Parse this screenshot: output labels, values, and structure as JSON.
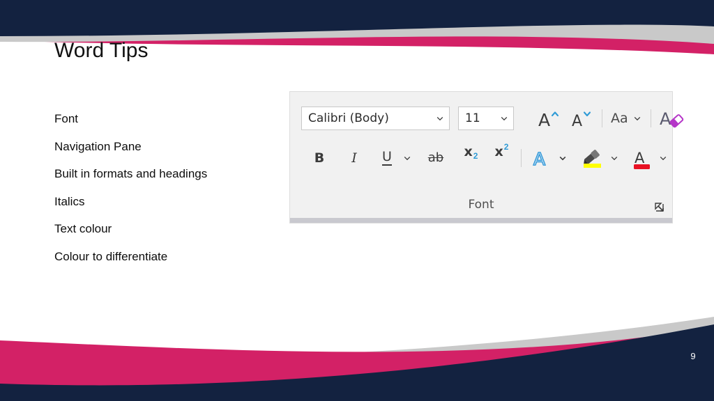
{
  "slide": {
    "title": "Word Tips",
    "page_number": "9",
    "colors": {
      "navy": "#132240",
      "pink": "#d32166",
      "silver": "#c9c9c9",
      "background": "#ffffff",
      "text": "#0d0d0d"
    }
  },
  "bullets": [
    {
      "label": "Font"
    },
    {
      "label": "Navigation Pane"
    },
    {
      "label": "Built in formats and headings"
    },
    {
      "label": "Italics"
    },
    {
      "label": "Text colour"
    },
    {
      "label": "Colour to differentiate"
    }
  ],
  "ribbon": {
    "group_label": "Font",
    "font_name": "Calibri (Body)",
    "font_size": "11",
    "icons": {
      "font_name_dropdown": "chevron-down-icon",
      "font_size_dropdown": "chevron-down-icon",
      "grow_font": "increase-font-size-icon",
      "shrink_font": "decrease-font-size-icon",
      "change_case": "change-case-icon",
      "change_case_label": "Aa",
      "clear_formatting": "clear-formatting-icon",
      "bold": "B",
      "italic": "I",
      "underline": "U",
      "underline_dropdown": "chevron-down-icon",
      "strikethrough": "ab",
      "subscript": "x",
      "subscript_index": "2",
      "superscript": "x",
      "superscript_index": "2",
      "text_effects": "A",
      "text_effects_dropdown": "chevron-down-icon",
      "text_highlight": "highlighter-pen-icon",
      "text_highlight_dropdown": "chevron-down-icon",
      "font_color": "A",
      "font_color_dropdown": "chevron-down-icon",
      "dialog_launcher": "dialog-box-launcher-icon"
    },
    "accent_colors": {
      "grow_shrink_chevron": "#2f9bd6",
      "sub_sup_index": "2f9bd6",
      "clear_formatting_eraser": "#b536c8",
      "text_effects_blue": "#1a8bd4",
      "highlight_yellow": "#ffff00",
      "font_color_red": "#e81123"
    }
  }
}
